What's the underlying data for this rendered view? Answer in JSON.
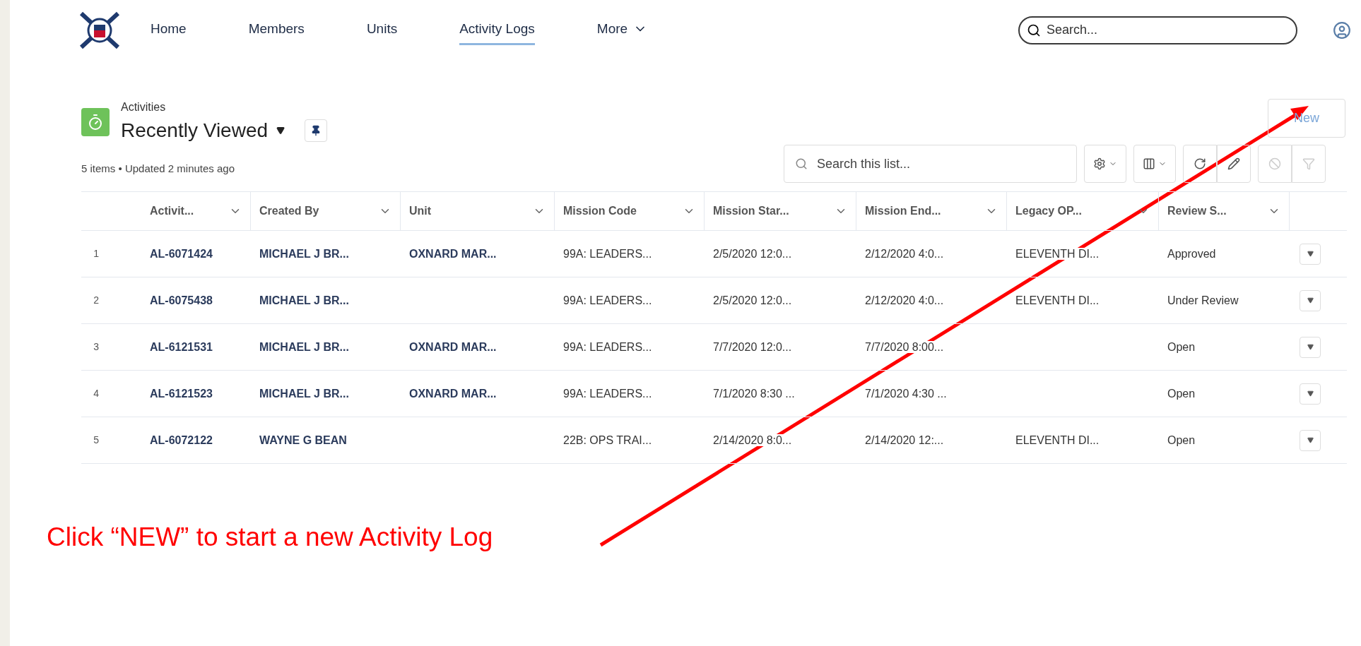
{
  "nav": {
    "items": [
      {
        "label": "Home",
        "selected": false
      },
      {
        "label": "Members",
        "selected": false
      },
      {
        "label": "Units",
        "selected": false
      },
      {
        "label": "Activity Logs",
        "selected": true
      },
      {
        "label": "More",
        "selected": false,
        "dropdown": true
      }
    ],
    "search": {
      "placeholder": "Search..."
    }
  },
  "header": {
    "object": "Activities",
    "view": "Recently Viewed",
    "status": "5 items • Updated 2 minutes ago",
    "new_button": "New",
    "list_search": {
      "placeholder": "Search this list..."
    }
  },
  "table": {
    "columns": [
      "Activit...",
      "Created By",
      "Unit",
      "Mission Code",
      "Mission Star...",
      "Mission End...",
      "Legacy OP...",
      "Review S..."
    ],
    "rows": [
      {
        "num": "1",
        "cells": [
          "AL-6071424",
          "MICHAEL J BR...",
          "OXNARD MAR...",
          "99A: LEADERS...",
          "2/5/2020 12:0...",
          "2/12/2020 4:0...",
          "ELEVENTH DI...",
          "Approved"
        ]
      },
      {
        "num": "2",
        "cells": [
          "AL-6075438",
          "MICHAEL J BR...",
          "",
          "99A: LEADERS...",
          "2/5/2020 12:0...",
          "2/12/2020 4:0...",
          "ELEVENTH DI...",
          "Under Review"
        ]
      },
      {
        "num": "3",
        "cells": [
          "AL-6121531",
          "MICHAEL J BR...",
          "OXNARD MAR...",
          "99A: LEADERS...",
          "7/7/2020 12:0...",
          "7/7/2020 8:00...",
          "",
          "Open"
        ]
      },
      {
        "num": "4",
        "cells": [
          "AL-6121523",
          "MICHAEL J BR...",
          "OXNARD MAR...",
          "99A: LEADERS...",
          "7/1/2020 8:30 ...",
          "7/1/2020 4:30 ...",
          "",
          "Open"
        ]
      },
      {
        "num": "5",
        "cells": [
          "AL-6072122",
          "WAYNE G BEAN",
          "",
          "22B: OPS TRAI...",
          "2/14/2020 8:0...",
          "2/14/2020 12:...",
          "ELEVENTH DI...",
          "Open"
        ]
      }
    ]
  },
  "annotation": {
    "text": "Click “NEW” to start a new Activity Log"
  }
}
